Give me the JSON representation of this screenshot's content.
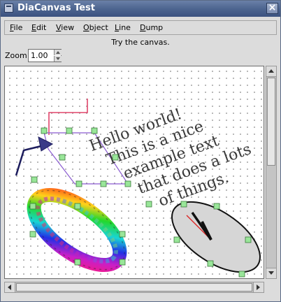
{
  "window": {
    "title": "DiaCanvas Test",
    "close_label": "×"
  },
  "menu": [
    {
      "key": "F",
      "rest": "ile"
    },
    {
      "key": "E",
      "rest": "dit"
    },
    {
      "key": "V",
      "rest": "iew"
    },
    {
      "key": "O",
      "rest": "bject"
    },
    {
      "key": "L",
      "rest": "ine"
    },
    {
      "key": "D",
      "rest": "ump"
    }
  ],
  "status_text": "Try the canvas.",
  "zoom": {
    "label": "Zoom:",
    "value": "1.00"
  },
  "canvas": {
    "text_lines": [
      "Hello world!",
      "This is a nice",
      "example text",
      "that does a lots",
      "of things."
    ]
  },
  "icons": {
    "title": "window-icon",
    "close": "close-icon",
    "arrow": "arrow-shape",
    "clock": "clock-ellipse"
  }
}
